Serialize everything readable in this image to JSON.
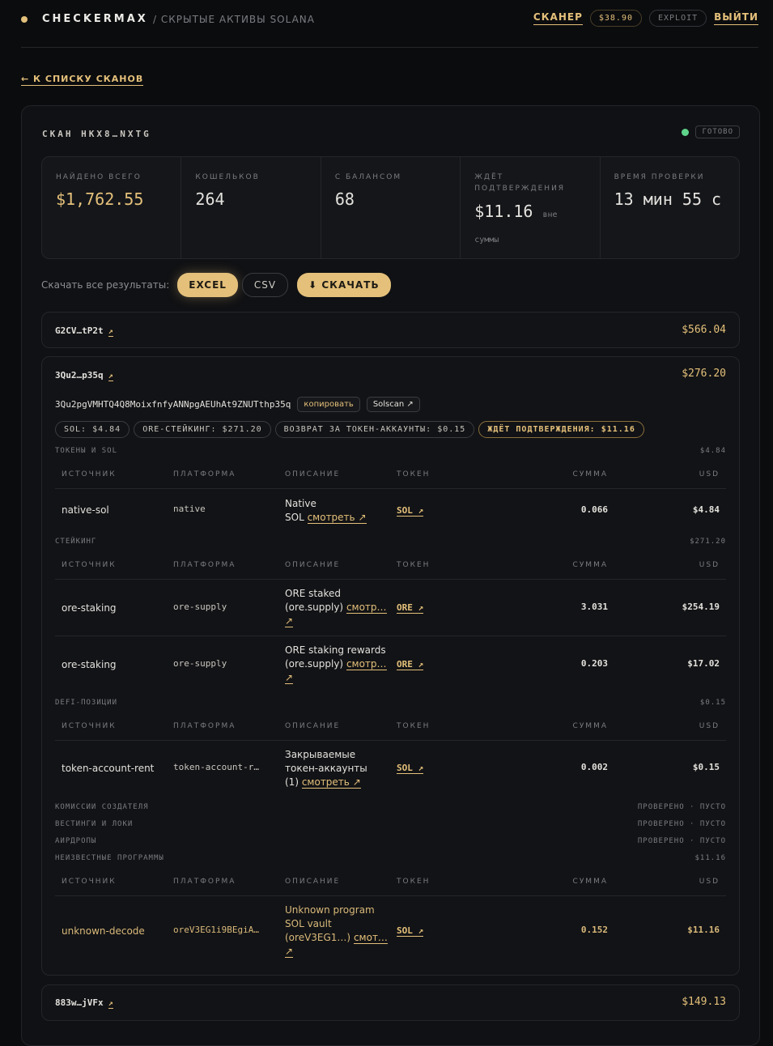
{
  "header": {
    "brand": "CHECKERMAX",
    "subtitle": "/ СКРЫТЫЕ АКТИВЫ SOLANA",
    "nav_scanner": "СКАНЕР",
    "balance": "$38.90",
    "exploit": "EXPLOIT",
    "logout": "ВЫЙТИ"
  },
  "back_link": "← К СПИСКУ СКАНОВ",
  "scan": {
    "title": "СКАН HKX8…NXTG",
    "status": "ГОТОВО"
  },
  "stats": [
    {
      "label": "НАЙДЕНО ВСЕГО",
      "value": "$1,762.55",
      "note": ""
    },
    {
      "label": "КОШЕЛЬКОВ",
      "value": "264",
      "note": ""
    },
    {
      "label": "С БАЛАНСОМ",
      "value": "68",
      "note": ""
    },
    {
      "label": "ЖДЁТ ПОДТВЕРЖДЕНИЯ",
      "value": "$11.16",
      "note": "вне суммы"
    },
    {
      "label": "ВРЕМЯ ПРОВЕРКИ",
      "value": "13 мин 55 с",
      "note": ""
    }
  ],
  "download": {
    "label": "Скачать все результаты:",
    "excel": "EXCEL",
    "csv": "CSV",
    "download": "⬇ СКАЧАТЬ"
  },
  "wallets": [
    {
      "address": "G2CV…tP2t",
      "arrow": "↗",
      "sum": "$566.04"
    },
    {
      "address": "3Qu2…p35q",
      "arrow": "↗",
      "sum": "$276.20",
      "full_address": "3Qu2pgVMHTQ4Q8MoixfnfyANNpgAEUhAt9ZNUTthp35q",
      "copy": "копировать",
      "solscan": "Solscan ↗",
      "chips": [
        "SOL: $4.84",
        "ORE-СТЕЙКИНГ: $271.20",
        "ВОЗВРАТ ЗА ТОКЕН-АККАУНТЫ: $0.15",
        "ЖДЁТ ПОДТВЕРЖДЕНИЯ: $11.16"
      ]
    },
    {
      "address": "883w…jVFx",
      "arrow": "↗",
      "sum": "$149.13"
    }
  ],
  "table_headers": {
    "source": "ИСТОЧНИК",
    "platform": "ПЛАТФОРМА",
    "description": "ОПИСАНИЕ",
    "token": "ТОКЕН",
    "amount": "СУММА",
    "usd": "USD"
  },
  "sections": {
    "tokens": {
      "name": "ТОКЕНЫ И SOL",
      "value": "$4.84"
    },
    "staking": {
      "name": "СТЕЙКИНГ",
      "value": "$271.20"
    },
    "defi": {
      "name": "DEFI-ПОЗИЦИИ",
      "value": "$0.15"
    },
    "creator": {
      "name": "КОМИССИИ СОЗДАТЕЛЯ",
      "value": "ПРОВЕРЕНО · ПУСТО"
    },
    "vesting": {
      "name": "ВЕСТИНГИ И ЛОКИ",
      "value": "ПРОВЕРЕНО · ПУСТО"
    },
    "airdrops": {
      "name": "АИРДРОПЫ",
      "value": "ПРОВЕРЕНО · ПУСТО"
    },
    "unknown": {
      "name": "НЕИЗВЕСТНЫЕ ПРОГРАММЫ",
      "value": "$11.16"
    }
  },
  "rows": {
    "native": {
      "source": "native-sol",
      "platform": "native",
      "desc1": "Native",
      "desc2": "SOL",
      "link": "смотреть ↗",
      "token": "SOL ↗",
      "amount": "0.066",
      "usd": "$4.84"
    },
    "ore1": {
      "source": "ore-staking",
      "platform": "ore-supply",
      "desc1": "ORE staked",
      "desc2": "(ore.supply)",
      "link": "смотр…",
      "link2": "↗",
      "token": "ORE ↗",
      "amount": "3.031",
      "usd": "$254.19"
    },
    "ore2": {
      "source": "ore-staking",
      "platform": "ore-supply",
      "desc1": "ORE staking rewards",
      "desc2": "(ore.supply)",
      "link": "смотр…",
      "link2": "↗",
      "token": "ORE ↗",
      "amount": "0.203",
      "usd": "$17.02"
    },
    "rent": {
      "source": "token-account-rent",
      "platform": "token-account-r…",
      "desc1": "Закрываемые",
      "desc2": "токен-аккаунты",
      "desc3": "(1)",
      "link": "смотреть ↗",
      "token": "SOL ↗",
      "amount": "0.002",
      "usd": "$0.15"
    },
    "unknown": {
      "source": "unknown-decode",
      "platform": "oreV3EG1i9BEgiA…",
      "desc1": "Unknown program",
      "desc2": "SOL vault",
      "desc3": "(oreV3EG1…)",
      "link": "смот…",
      "link2": "↗",
      "token": "SOL ↗",
      "amount": "0.152",
      "usd": "$11.16"
    }
  }
}
